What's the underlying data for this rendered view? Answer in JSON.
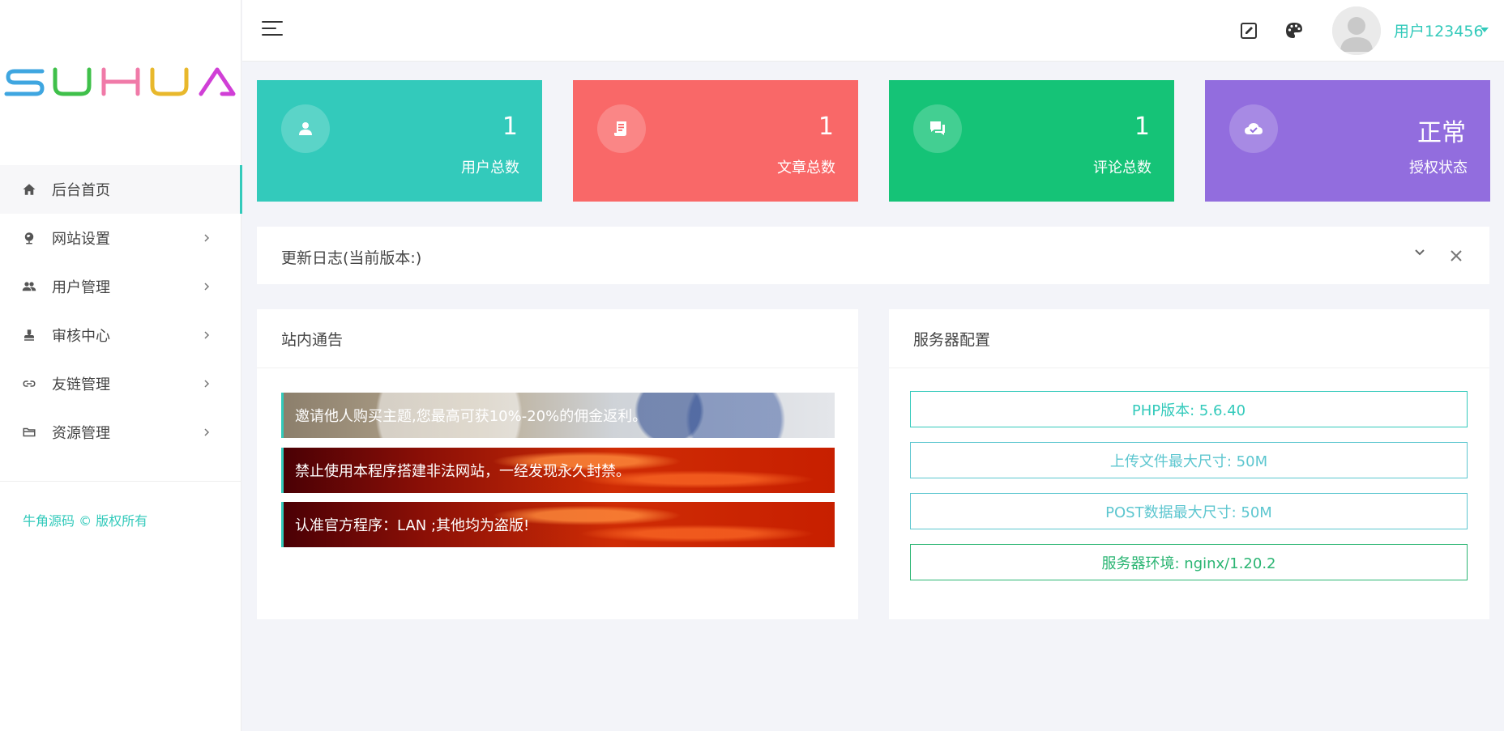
{
  "brand": {
    "logo_text": "SUHUA",
    "logo_colors": [
      "#3fa6e0",
      "#3fc04a",
      "#f07aa8",
      "#e8b82c",
      "#d03fd6"
    ]
  },
  "sidebar": {
    "items": [
      {
        "label": "后台首页",
        "icon": "home-icon",
        "active": true,
        "has_children": false
      },
      {
        "label": "网站设置",
        "icon": "globe-icon",
        "active": false,
        "has_children": true
      },
      {
        "label": "用户管理",
        "icon": "users-icon",
        "active": false,
        "has_children": true
      },
      {
        "label": "审核中心",
        "icon": "stamp-icon",
        "active": false,
        "has_children": true
      },
      {
        "label": "友链管理",
        "icon": "link-icon",
        "active": false,
        "has_children": true
      },
      {
        "label": "资源管理",
        "icon": "folder-icon",
        "active": false,
        "has_children": true
      }
    ],
    "footer": "牛角源码 © 版权所有"
  },
  "header": {
    "user_name": "用户123456",
    "icons": [
      "menu-icon",
      "edit-icon",
      "palette-icon",
      "avatar"
    ]
  },
  "stats": [
    {
      "value": "1",
      "label": "用户总数",
      "icon": "user-icon",
      "color": "#33cabb"
    },
    {
      "value": "1",
      "label": "文章总数",
      "icon": "article-icon",
      "color": "#f96868"
    },
    {
      "value": "1",
      "label": "评论总数",
      "icon": "comment-icon",
      "color": "#15c377"
    },
    {
      "value": "正常",
      "label": "授权状态",
      "icon": "cloud-check-icon",
      "color": "#926dde"
    }
  ],
  "update_log": {
    "title": "更新日志(当前版本:)"
  },
  "notice_panel": {
    "title": "站内通告",
    "items": [
      "邀请他人购买主题,您最高可获10%-20%的佣金返利。",
      "禁止使用本程序搭建非法网站，一经发现永久封禁。",
      "认准官方程序：LAN ;其他均为盗版!"
    ]
  },
  "server_panel": {
    "title": "服务器配置",
    "items": [
      "PHP版本: 5.6.40",
      "上传文件最大尺寸: 50M",
      "POST数据最大尺寸: 50M",
      "服务器环境: nginx/1.20.2"
    ]
  },
  "colors": {
    "accent": "#33cabb",
    "background": "#f3f4f9"
  }
}
